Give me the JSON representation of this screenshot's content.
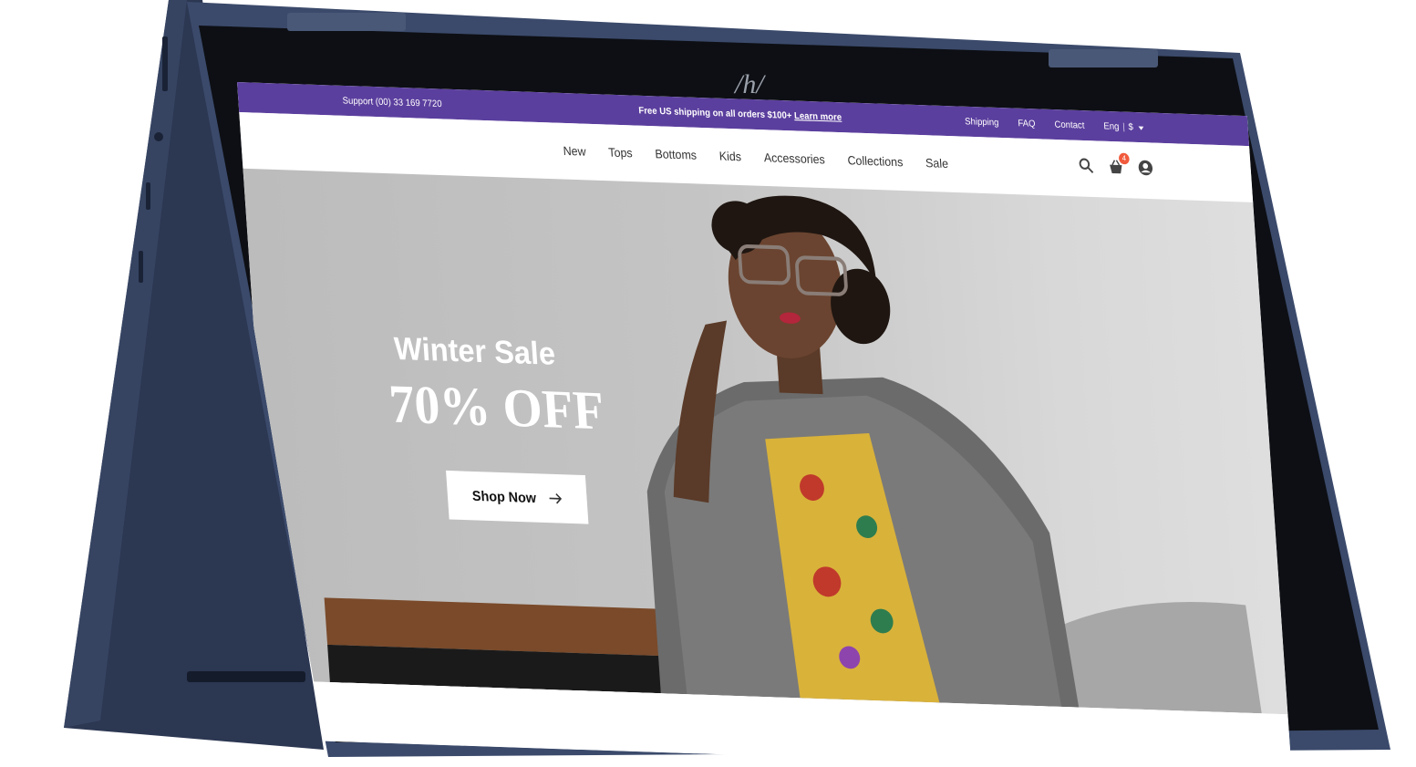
{
  "topbar": {
    "support": "Support (00) 33 169 7720",
    "promo_text": "Free US shipping on all orders $100+",
    "promo_link": "Learn more",
    "links": [
      "Shipping",
      "FAQ",
      "Contact"
    ],
    "language": "Eng",
    "currency": "$"
  },
  "nav": {
    "items": [
      "New",
      "Tops",
      "Bottoms",
      "Kids",
      "Accessories",
      "Collections",
      "Sale"
    ],
    "cart_count": "4"
  },
  "hero": {
    "title": "Winter Sale",
    "discount": "70% OFF",
    "cta": "Shop Now"
  },
  "colors": {
    "topbar_bg": "#5b3f9e",
    "cart_badge": "#f15a3c",
    "device_body": "#2f3a52"
  }
}
